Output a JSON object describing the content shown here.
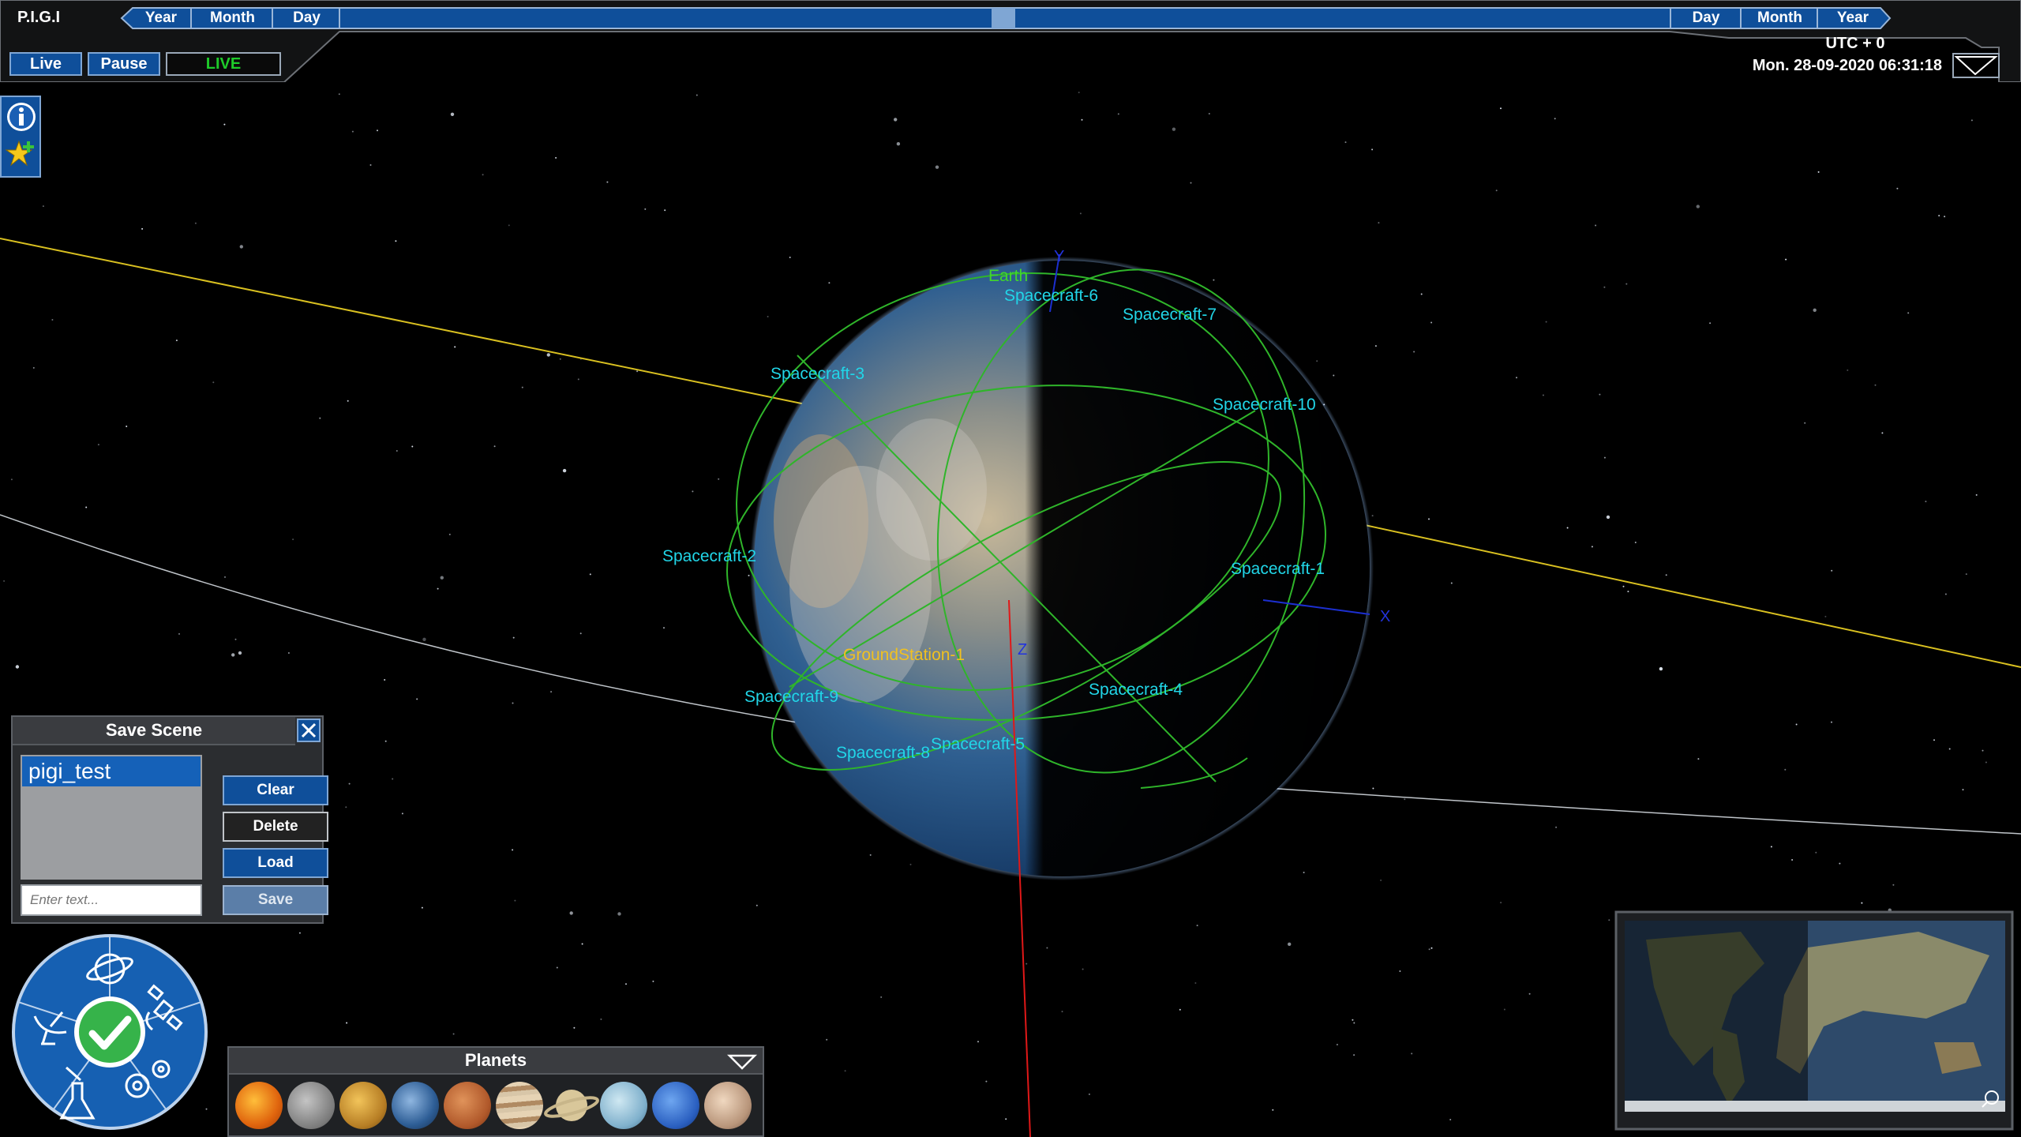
{
  "app": {
    "title": "P.I.G.I"
  },
  "timeline": {
    "left_labels": [
      "Year",
      "Month",
      "Day"
    ],
    "right_labels": [
      "Day",
      "Month",
      "Year"
    ],
    "playhead_position": 0.5
  },
  "controls": {
    "live_label": "Live",
    "pause_label": "Pause",
    "status_label": "LIVE"
  },
  "clock": {
    "timezone": "UTC + 0",
    "datetime": "Mon. 28-09-2020 06:31:18"
  },
  "side_icons": [
    {
      "name": "info-icon"
    },
    {
      "name": "favorite-add-icon"
    }
  ],
  "scene": {
    "earth_label": "Earth",
    "ground_station_label": "GroundStation-1",
    "spacecraft": [
      "Spacecraft-1",
      "Spacecraft-2",
      "Spacecraft-3",
      "Spacecraft-4",
      "Spacecraft-5",
      "Spacecraft-6",
      "Spacecraft-7",
      "Spacecraft-8",
      "Spacecraft-9",
      "Spacecraft-10"
    ],
    "axes": {
      "x": "X",
      "y": "Y",
      "z": "Z"
    }
  },
  "save_scene": {
    "title": "Save Scene",
    "items": [
      "pigi_test"
    ],
    "selected_index": 0,
    "input_placeholder": "Enter text...",
    "input_value": "",
    "buttons": {
      "clear": "Clear",
      "delete": "Delete",
      "load": "Load",
      "save": "Save"
    }
  },
  "radial_menu": {
    "segments": [
      "planet-icon",
      "satellite-icon",
      "settings-icon",
      "lab-flask-icon",
      "ground-dish-icon"
    ],
    "center": "confirm-check-icon"
  },
  "planets_bar": {
    "title": "Planets",
    "planets": [
      "sun",
      "moon",
      "venus",
      "earth",
      "mars",
      "jupiter",
      "saturn",
      "uranus",
      "neptune",
      "pluto"
    ]
  },
  "colors": {
    "ui_blue": "#0f4f9a",
    "spacecraft_label": "#21d6e8",
    "orbit": "#2fb52a",
    "ground_station": "#f0c020",
    "live_green": "#1ecb2a"
  }
}
